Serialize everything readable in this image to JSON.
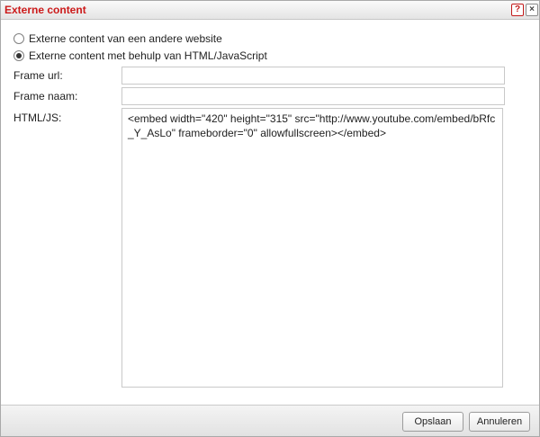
{
  "dialog": {
    "title": "Externe content",
    "help_label": "?",
    "close_label": "×"
  },
  "options": {
    "external_website": "Externe content van een andere website",
    "html_javascript": "Externe content met behulp van HTML/JavaScript",
    "selected": "html_javascript"
  },
  "fields": {
    "frame_url_label": "Frame url:",
    "frame_url_value": "",
    "frame_name_label": "Frame naam:",
    "frame_name_value": "",
    "html_label": "HTML/JS:",
    "html_value": "<embed width=\"420\" height=\"315\" src=\"http://www.youtube.com/embed/bRfc_Y_AsLo\" frameborder=\"0\" allowfullscreen></embed>"
  },
  "footer": {
    "save_label": "Opslaan",
    "cancel_label": "Annuleren"
  }
}
